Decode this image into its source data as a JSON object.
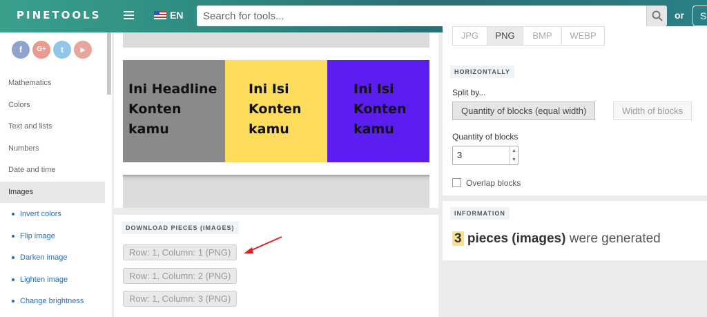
{
  "header": {
    "logo": "PINETOOLS",
    "language": "EN",
    "search_placeholder": "Search for tools...",
    "or": "or",
    "signup_label": "S"
  },
  "sidebar": {
    "social": [
      {
        "name": "facebook",
        "label": "f",
        "color": "#8fa3cf"
      },
      {
        "name": "google-plus",
        "label": "G+",
        "color": "#e89a8e"
      },
      {
        "name": "twitter",
        "label": "t",
        "color": "#8fc6ea"
      },
      {
        "name": "youtube",
        "label": "▶",
        "color": "#e8a59c"
      }
    ],
    "categories": [
      "Mathematics",
      "Colors",
      "Text and lists",
      "Numbers",
      "Date and time",
      "Images"
    ],
    "active_category": "Images",
    "sub_items": [
      "Invert colors",
      "Flip image",
      "Darken image",
      "Lighten image",
      "Change brightness"
    ]
  },
  "preview": {
    "blocks": [
      {
        "text": "Ini Headline\nKonten\nkamu",
        "color": "#8a8a8a"
      },
      {
        "text": "Ini Isi\nKonten\nkamu",
        "color": "#fddc5c"
      },
      {
        "text": "Ini Isi\nKonten\nkamu",
        "color": "#5b1df0"
      }
    ]
  },
  "download": {
    "title": "DOWNLOAD PIECES (IMAGES)",
    "pieces": [
      "Row: 1, Column: 1 (PNG)",
      "Row: 1, Column: 2 (PNG)",
      "Row: 1, Column: 3 (PNG)"
    ]
  },
  "options": {
    "formats": [
      "JPG",
      "PNG",
      "BMP",
      "WEBP"
    ],
    "selected_format": "PNG",
    "horizontally_title": "HORIZONTALLY",
    "split_by_label": "Split by...",
    "split_options": [
      "Quantity of blocks (equal width)",
      "Width of blocks"
    ],
    "quantity_label": "Quantity of blocks",
    "quantity_value": "3",
    "overlap_label": "Overlap blocks"
  },
  "information": {
    "title": "INFORMATION",
    "count": "3",
    "bold_text": "pieces (images)",
    "rest_text": "were generated"
  }
}
